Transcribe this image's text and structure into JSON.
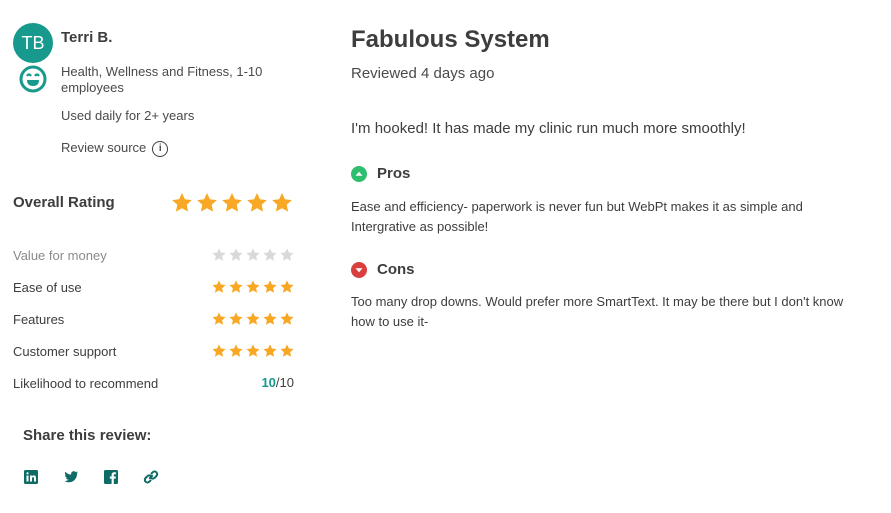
{
  "reviewer": {
    "initials": "TB",
    "name": "Terri B.",
    "industry": "Health, Wellness and Fitness, 1-10 employees",
    "usage": "Used daily for 2+ years",
    "review_source_label": "Review source",
    "avatar_color": "#17998d"
  },
  "ratings": {
    "overall_label": "Overall Rating",
    "overall_stars": 5,
    "max_stars": 5,
    "star_color": "#f8a825",
    "empty_star_color": "#d9d9d9",
    "rows": [
      {
        "label": "Value for money",
        "stars": 0
      },
      {
        "label": "Ease of use",
        "stars": 5
      },
      {
        "label": "Features",
        "stars": 5
      },
      {
        "label": "Customer support",
        "stars": 5
      }
    ],
    "likelihood_label": "Likelihood to recommend",
    "likelihood_value": "10",
    "likelihood_max": "/10"
  },
  "share": {
    "title": "Share this review:",
    "icons": [
      "linkedin-icon",
      "twitter-icon",
      "facebook-icon",
      "link-icon"
    ],
    "icon_color": "#0e6b66"
  },
  "review": {
    "title": "Fabulous System",
    "reviewed": "Reviewed 4 days ago",
    "summary": "I'm hooked! It has made my clinic run much more smoothly!",
    "pros_label": "Pros",
    "pros_text": "Ease and efficiency- paperwork is never fun but WebPt makes it as simple and Intergrative as possible!",
    "cons_label": "Cons",
    "cons_text": "Too many drop downs. Would prefer more SmartText. It may be there but I don't know how to use it-",
    "pros_color": "#2fbd6e",
    "cons_color": "#d8403f"
  }
}
